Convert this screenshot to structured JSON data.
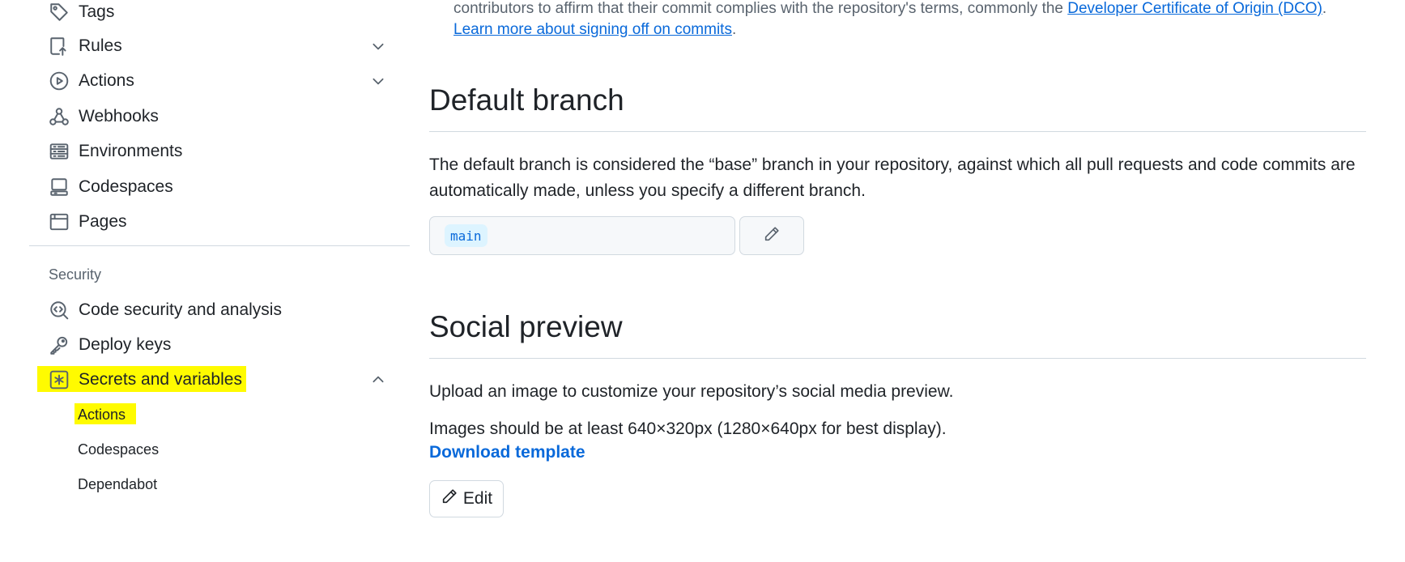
{
  "sidebar": {
    "items": [
      {
        "label": "Tags",
        "icon": "tag-icon"
      },
      {
        "label": "Rules",
        "icon": "repo-push-icon",
        "chevron": "chevron-down-icon"
      },
      {
        "label": "Actions",
        "icon": "play-icon",
        "chevron": "chevron-down-icon"
      },
      {
        "label": "Webhooks",
        "icon": "webhook-icon"
      },
      {
        "label": "Environments",
        "icon": "server-icon"
      },
      {
        "label": "Codespaces",
        "icon": "codespaces-icon"
      },
      {
        "label": "Pages",
        "icon": "browser-icon"
      }
    ],
    "security_section": {
      "title": "Security",
      "items": [
        {
          "label": "Code security and analysis",
          "icon": "codescan-icon"
        },
        {
          "label": "Deploy keys",
          "icon": "key-icon"
        },
        {
          "label": "Secrets and variables",
          "icon": "key-asterisk-icon",
          "chevron": "chevron-up-icon",
          "highlighted": true
        }
      ],
      "sub_items": [
        {
          "label": "Actions",
          "highlighted": true
        },
        {
          "label": "Codespaces"
        },
        {
          "label": "Dependabot"
        }
      ]
    },
    "highlight_color": "#fffb00"
  },
  "main": {
    "intro": {
      "text": "contributors to affirm that their commit complies with the repository's terms, commonly the ",
      "link1": "Developer Certificate of Origin (DCO)",
      "sep": ". ",
      "link2": "Learn more about signing off on commits",
      "end": "."
    },
    "default_branch": {
      "heading": "Default branch",
      "description": "The default branch is considered the “base” branch in your repository, against which all pull requests and code commits are automatically made, unless you specify a different branch.",
      "branch_name": "main",
      "edit_icon": "pencil-icon"
    },
    "social_preview": {
      "heading": "Social preview",
      "description": "Upload an image to customize your repository’s social media preview.",
      "size_note": "Images should be at least 640×320px (1280×640px for best display).",
      "download_link": "Download template",
      "edit_label": "Edit",
      "edit_icon": "pencil-icon"
    }
  },
  "colors": {
    "accent": "#0969da",
    "text": "#1f2328",
    "muted": "#59636e",
    "border": "#d1d9e0"
  }
}
